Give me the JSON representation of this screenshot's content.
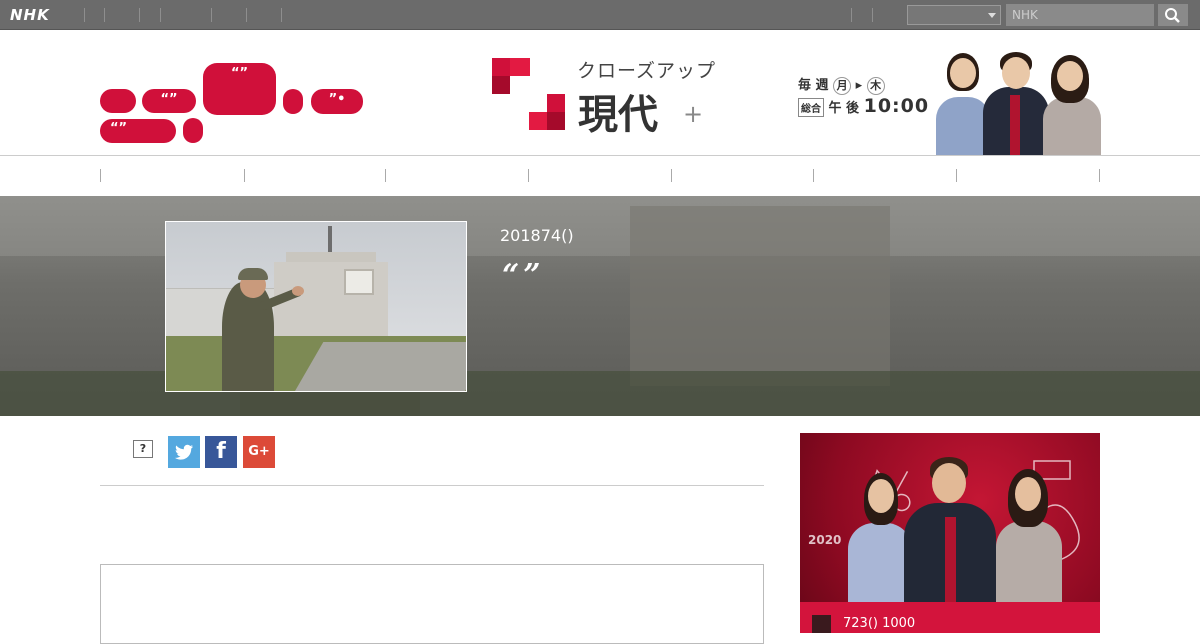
{
  "topbar": {
    "logo": "NHK",
    "search_placeholder": "NHK",
    "search_icon": "search-icon",
    "colors": {
      "bar": "#6b6b6b"
    }
  },
  "header": {
    "speech_pills": [
      {
        "text": "“”"
      },
      {
        "text": "“”"
      },
      {
        "text": "”•"
      },
      {
        "text": "“”"
      }
    ],
    "brand": {
      "title_small": "クローズアップ",
      "title_big": "現代",
      "plus": "+"
    },
    "schedule": {
      "days_prefix": "毎 週",
      "day_start": "月",
      "arrow": "▸",
      "day_end": "木",
      "channel": "総合",
      "time_prefix": "午 後",
      "time": "10:00"
    },
    "accent_color": "#d0103a"
  },
  "hero": {
    "date": "201874()",
    "title": "“”"
  },
  "share": {
    "question_label": "?",
    "twitter_label": "🐦",
    "facebook_label": "f",
    "googleplus_label": "G+"
  },
  "promo": {
    "date_time": "723() 1000",
    "doodle_year": "2020"
  }
}
